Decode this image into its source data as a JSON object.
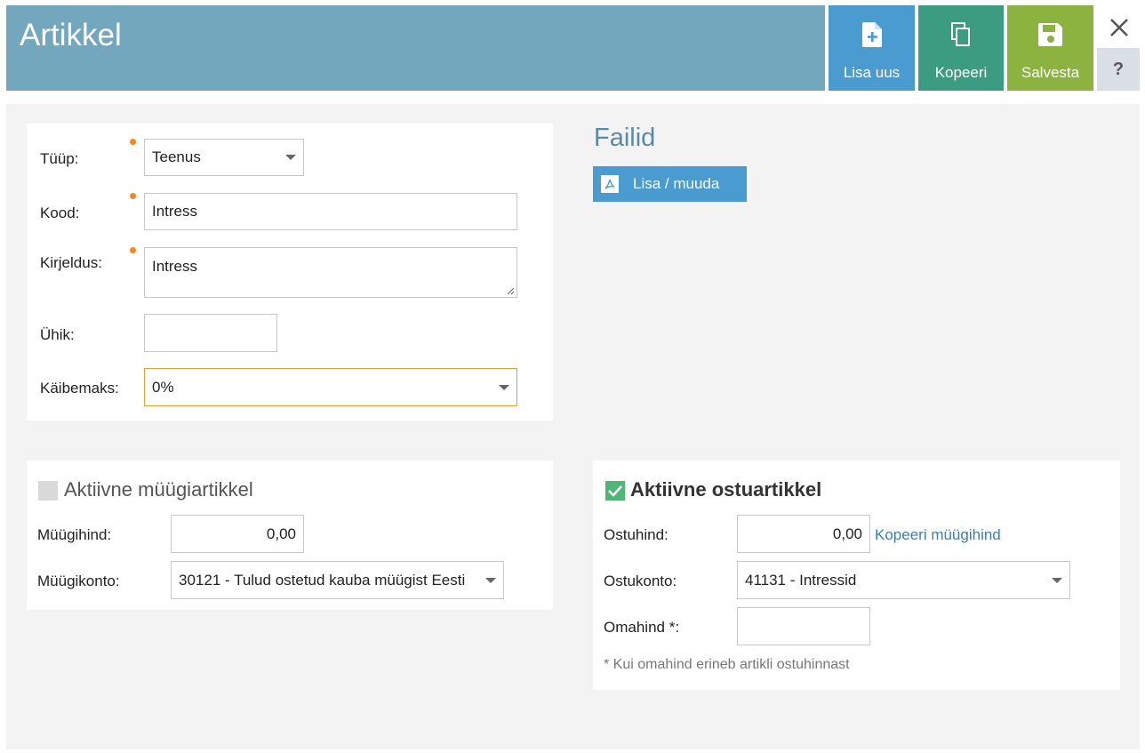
{
  "header": {
    "title": "Artikkel"
  },
  "toolbar": {
    "new_label": "Lisa uus",
    "copy_label": "Kopeeri",
    "save_label": "Salvesta",
    "help_label": "?"
  },
  "form": {
    "type_label": "Tüüp:",
    "type_value": "Teenus",
    "code_label": "Kood:",
    "code_value": "Intress",
    "desc_label": "Kirjeldus:",
    "desc_value": "Intress",
    "unit_label": "Ühik:",
    "unit_value": "",
    "vat_label": "Käibemaks:",
    "vat_value": "0%"
  },
  "files": {
    "title": "Failid",
    "button_label": "Lisa / muuda"
  },
  "sale": {
    "title": "Aktiivne müügiartikkel",
    "checked": false,
    "price_label": "Müügihind:",
    "price_value": "0,00",
    "account_label": "Müügikonto:",
    "account_value": "30121 - Tulud ostetud kauba müügist Eesti"
  },
  "purchase": {
    "title": "Aktiivne ostuartikkel",
    "checked": true,
    "price_label": "Ostuhind:",
    "price_value": "0,00",
    "copy_link": "Kopeeri müügihind",
    "account_label": "Ostukonto:",
    "account_value": "41131 - Intressid",
    "cost_label": "Omahind *:",
    "cost_value": "",
    "note": "* Kui omahind erineb artikli ostuhinnast"
  },
  "colors": {
    "header": "#72a7bd",
    "new_button": "#4a9bcf",
    "copy_button": "#3c9c82",
    "save_button": "#8cb23f",
    "required_dot": "#f08a24",
    "checkbox_checked": "#4fb678"
  }
}
